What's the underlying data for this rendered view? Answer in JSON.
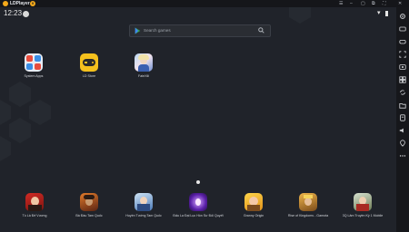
{
  "titlebar": {
    "app_name": "LDPlayer",
    "version_badge": "9"
  },
  "statusbar": {
    "time": "12:23"
  },
  "search": {
    "placeholder": "Search games"
  },
  "desktop_apps": [
    {
      "label": "System Apps",
      "icon": "system-apps-folder-icon"
    },
    {
      "label": "LD Store",
      "icon": "ld-store-gamepad-icon"
    },
    {
      "label": "FateXiii",
      "icon": "anime-girl-icon"
    }
  ],
  "dock_apps": [
    {
      "label": "Tú Là Đế Vương",
      "icon": "game-icon-red"
    },
    {
      "label": "Bá Đầu Tam Quốc",
      "icon": "game-icon-warrior"
    },
    {
      "label": "Huyền Tướng Tam Quốc",
      "icon": "game-icon-hero"
    },
    {
      "label": "Đấu La Đại Lục Hồn Sư Đối Quyết",
      "icon": "game-icon-purple"
    },
    {
      "label": "Granny Origin",
      "icon": "game-icon-yellow"
    },
    {
      "label": "Rise of Kingdoms - Gamota",
      "icon": "game-icon-king"
    },
    {
      "label": "3Q Lâm Truyền Kỳ 1 Mobile",
      "icon": "game-icon-general"
    }
  ],
  "sidebar_icons": [
    "settings-icon",
    "keyboard-icon",
    "gamepad-icon",
    "screenshot-icon",
    "record-icon",
    "multi-instance-icon",
    "sync-icon",
    "folder-icon",
    "apk-icon",
    "volume-icon",
    "location-icon",
    "more-icon"
  ],
  "colors": {
    "accent": "#f4a91b",
    "background": "#20232a",
    "sidebar": "#16171b"
  }
}
